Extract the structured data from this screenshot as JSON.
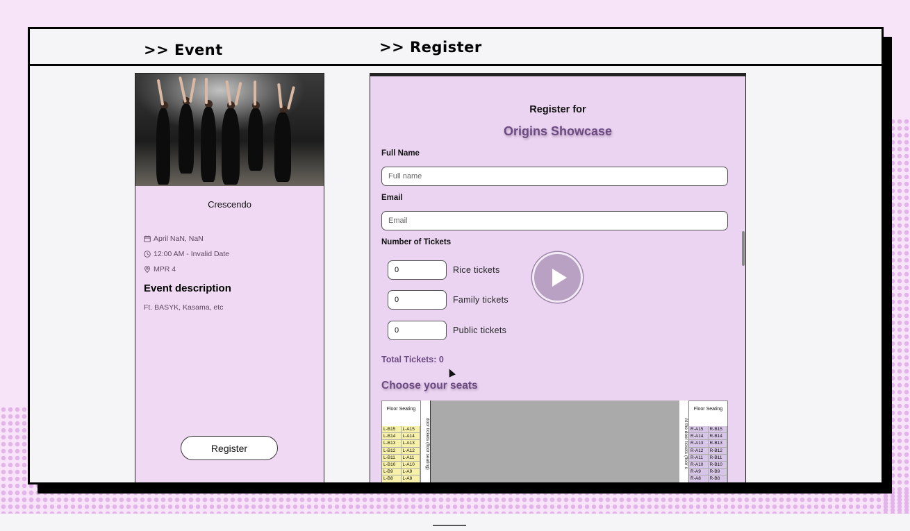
{
  "sections": {
    "event_title": ">> Event",
    "register_title": ">> Register"
  },
  "event": {
    "name": "Crescendo",
    "date": "April NaN, NaN",
    "time": "12:00 AM - Invalid Date",
    "location": "MPR 4",
    "description_heading": "Event description",
    "description": "Ft. BASYK, Kasama, etc",
    "register_label": "Register"
  },
  "form": {
    "heading": "Register for",
    "event_name": "Origins Showcase",
    "full_name_label": "Full Name",
    "full_name_placeholder": "Full name",
    "email_label": "Email",
    "email_placeholder": "Email",
    "tickets_label": "Number of Tickets",
    "tickets": [
      {
        "value": "0",
        "label": "Rice tickets"
      },
      {
        "value": "0",
        "label": "Family tickets"
      },
      {
        "value": "0",
        "label": "Public tickets"
      }
    ],
    "total": "Total Tickets: 0",
    "seats_heading": "Choose your seats"
  },
  "seat_map": {
    "floor_label": "Floor Seating",
    "left_vertical": "door tickets (floor seating)",
    "right_vertical": "At the door tickets (floor s",
    "left_rows": [
      [
        "L-B15",
        "L-A15"
      ],
      [
        "L-B14",
        "L-A14"
      ],
      [
        "L-B13",
        "L-A13"
      ],
      [
        "L-B12",
        "L-A12"
      ],
      [
        "L-B11",
        "L-A11"
      ],
      [
        "L-B10",
        "L-A10"
      ],
      [
        "L-B9",
        "L-A9"
      ],
      [
        "L-B8",
        "L-A8"
      ]
    ],
    "right_rows": [
      [
        "R-A15",
        "R-B15"
      ],
      [
        "R-A14",
        "R-B14"
      ],
      [
        "R-A13",
        "R-B13"
      ],
      [
        "R-A12",
        "R-B12"
      ],
      [
        "R-A11",
        "R-B11"
      ],
      [
        "R-A10",
        "R-B10"
      ],
      [
        "R-A9",
        "R-B9"
      ],
      [
        "R-A8",
        "R-B8"
      ]
    ]
  },
  "icons": {
    "calendar": "calendar-icon",
    "clock": "clock-icon",
    "location": "map-pin-icon",
    "play": "play-icon"
  },
  "colors": {
    "accent_purple": "#6d4a82",
    "panel_bg": "#ead4f1",
    "card_bg": "#f0d9f3",
    "page_bg": "#f7e4f8"
  }
}
